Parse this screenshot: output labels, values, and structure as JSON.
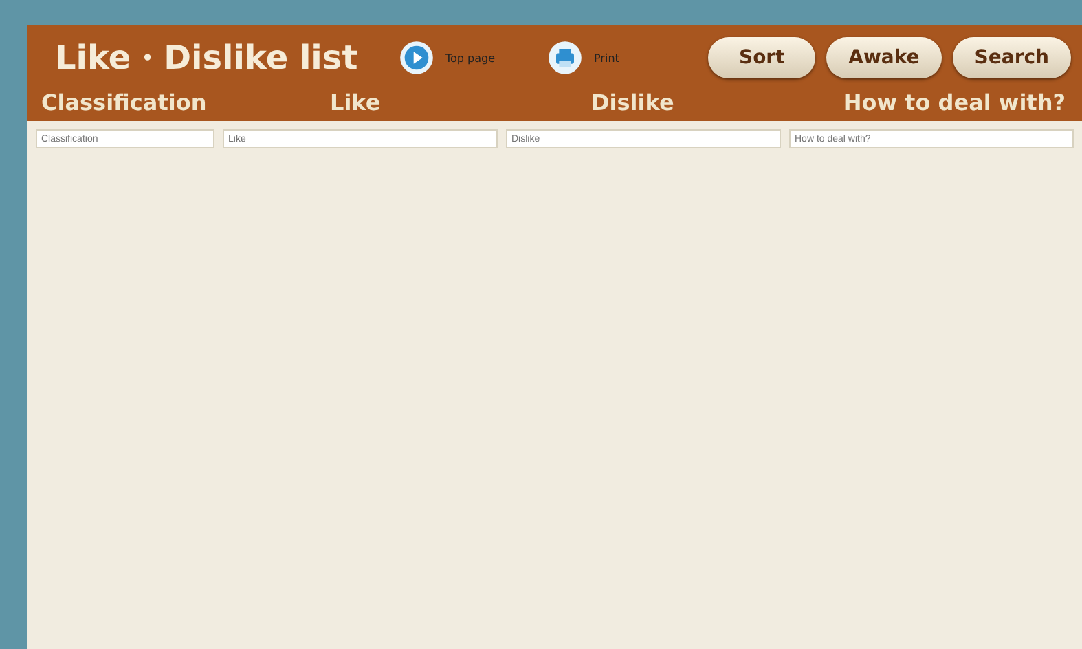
{
  "header": {
    "title": "Like・Dislike list",
    "links": [
      {
        "kind": "play",
        "label": "Top page"
      },
      {
        "kind": "print",
        "label": "Print"
      }
    ],
    "buttons": [
      "Sort",
      "Awake",
      "Search"
    ]
  },
  "columns": [
    "Classification",
    "Like",
    "Dislike",
    "How to deal with?"
  ],
  "fields": [
    {
      "placeholder": "Classification"
    },
    {
      "placeholder": "Like"
    },
    {
      "placeholder": "Dislike"
    },
    {
      "placeholder": "How to deal with?"
    }
  ]
}
